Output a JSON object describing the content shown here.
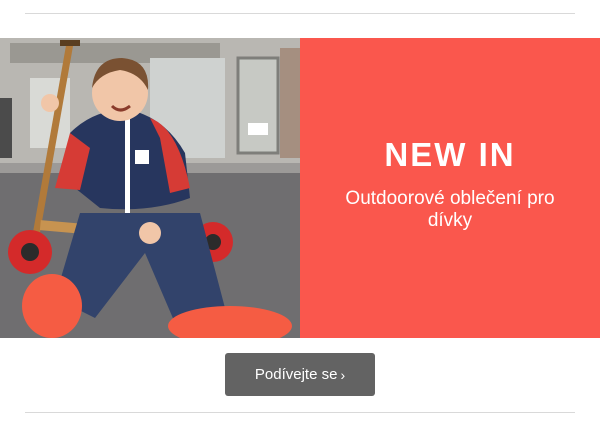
{
  "promo": {
    "title": "NEW IN",
    "subtitle": "Outdoorové oblečení pro dívky",
    "background": "#fa574d"
  },
  "cta": {
    "label": "Podívejte se",
    "arrow": "›"
  },
  "photo": {
    "alt": "Girl in navy outdoor suit sitting on a scooter"
  }
}
